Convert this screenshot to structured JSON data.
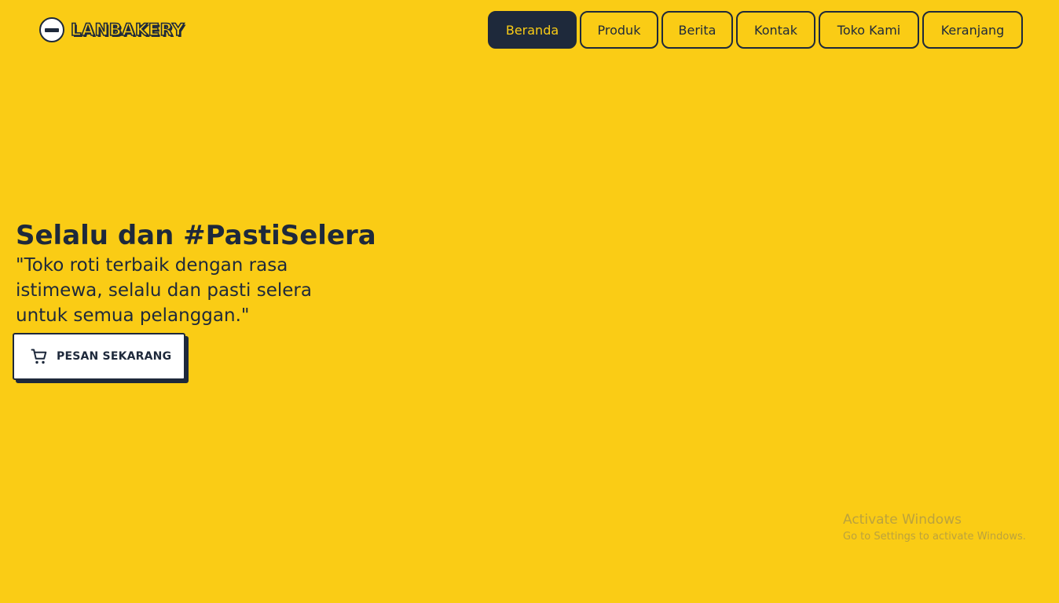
{
  "brand": {
    "name": "LANBAKERY",
    "logo_icon": "bakery-logo-icon"
  },
  "nav": {
    "items": [
      {
        "label": "Beranda",
        "active": true
      },
      {
        "label": "Produk",
        "active": false
      },
      {
        "label": "Berita",
        "active": false
      },
      {
        "label": "Kontak",
        "active": false
      },
      {
        "label": "Toko Kami",
        "active": false
      },
      {
        "label": "Keranjang",
        "active": false
      }
    ]
  },
  "hero": {
    "title": "Selalu dan #PastiSelera",
    "tagline": "\"Toko roti terbaik dengan rasa istimewa, selalu dan pasti selera untuk semua pelanggan.\"",
    "cta_label": "PESAN SEKARANG",
    "cta_icon": "shopping-cart-icon"
  },
  "watermark": {
    "title": "Activate Windows",
    "subtitle": "Go to Settings to activate Windows."
  },
  "colors": {
    "background": "#FACC15",
    "primary_dark": "#1E293B",
    "button_light": "#FFFFFF"
  }
}
